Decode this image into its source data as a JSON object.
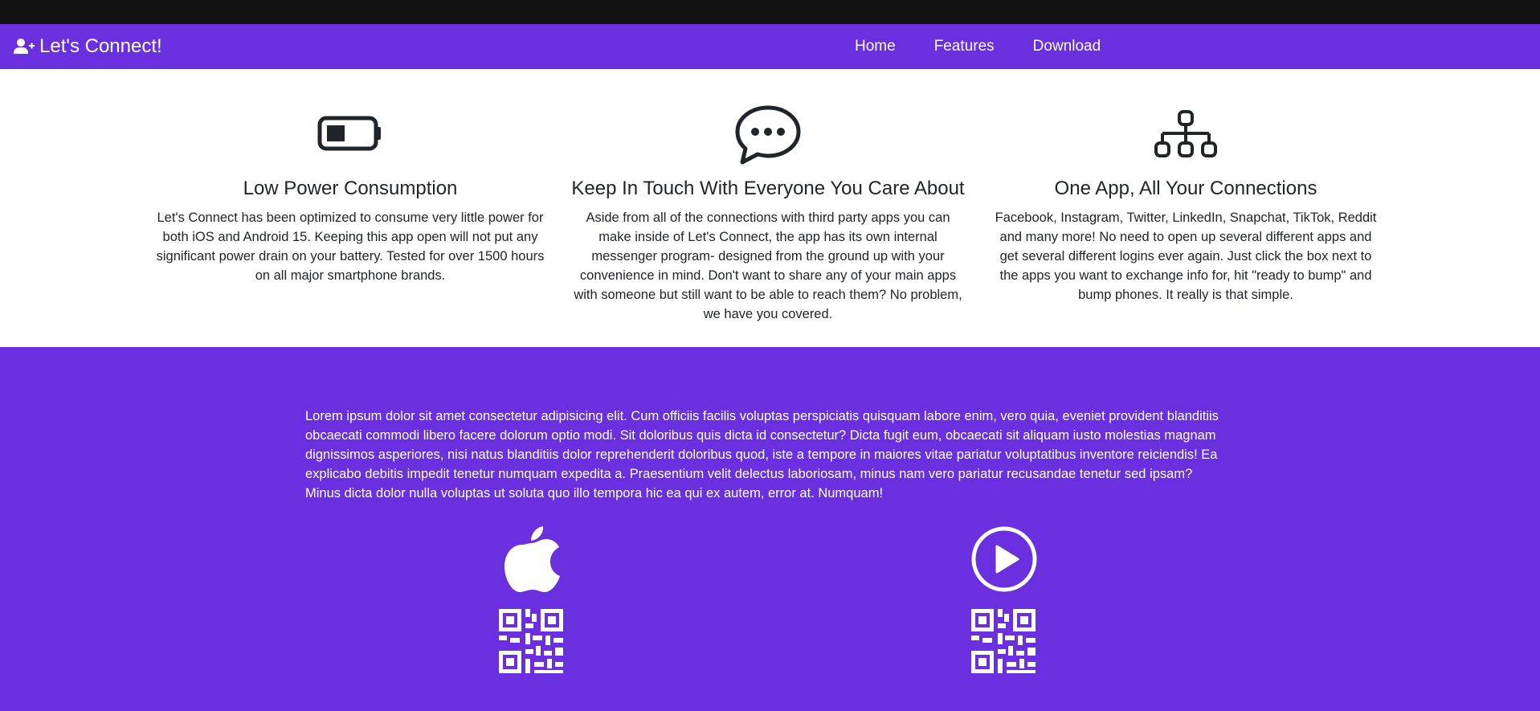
{
  "brand": {
    "name": "Let's Connect!",
    "icon": "user-plus-icon"
  },
  "nav": {
    "items": [
      "Home",
      "Features",
      "Download"
    ]
  },
  "features": [
    {
      "icon": "battery-icon",
      "title": "Low Power Consumption",
      "text": "Let's Connect has been optimized to consume very little power for both iOS and Android 15. Keeping this app open will not put any significant power drain on your battery. Tested for over 1500 hours on all major smartphone brands."
    },
    {
      "icon": "chat-dots-icon",
      "title": "Keep In Touch With Everyone You Care About",
      "text": "Aside from all of the connections with third party apps you can make inside of Let's Connect, the app has its own internal messenger program- designed from the ground up with your convenience in mind. Don't want to share any of your main apps with someone but still want to be able to reach them? No problem, we have you covered."
    },
    {
      "icon": "network-diagram-icon",
      "title": "One App, All Your Connections",
      "text": "Facebook, Instagram, Twitter, LinkedIn, Snapchat, TikTok, Reddit and many more! No need to open up several different apps and get several different logins ever again. Just click the box next to the apps you want to exchange info for, hit \"ready to bump\" and bump phones. It really is that simple."
    }
  ],
  "download": {
    "text": "Lorem ipsum dolor sit amet consectetur adipisicing elit. Cum officiis facilis voluptas perspiciatis quisquam labore enim, vero quia, eveniet provident blanditiis obcaecati commodi libero facere dolorum optio modi. Sit doloribus quis dicta id consectetur? Dicta fugit eum, obcaecati sit aliquam iusto molestias magnam dignissimos asperiores, nisi natus blanditiis dolor reprehenderit doloribus quod, iste a tempore in maiores vitae pariatur voluptatibus inventore reiciendis! Ea explicabo debitis impedit tenetur numquam expedita a. Praesentium velit delectus laboriosam, minus nam vero pariatur recusandae tenetur sed ipsam? Minus dicta dolor nulla voluptas ut soluta quo illo tempora hic ea qui ex autem, error at. Numquam!",
    "stores": [
      {
        "icon": "apple-icon",
        "qr_icon": "qr-code-icon"
      },
      {
        "icon": "play-circle-icon",
        "qr_icon": "qr-code-icon"
      }
    ]
  },
  "colors": {
    "primary": "#6a2fde",
    "top_strip": "#111111",
    "text_dark": "#212529",
    "white": "#ffffff"
  }
}
